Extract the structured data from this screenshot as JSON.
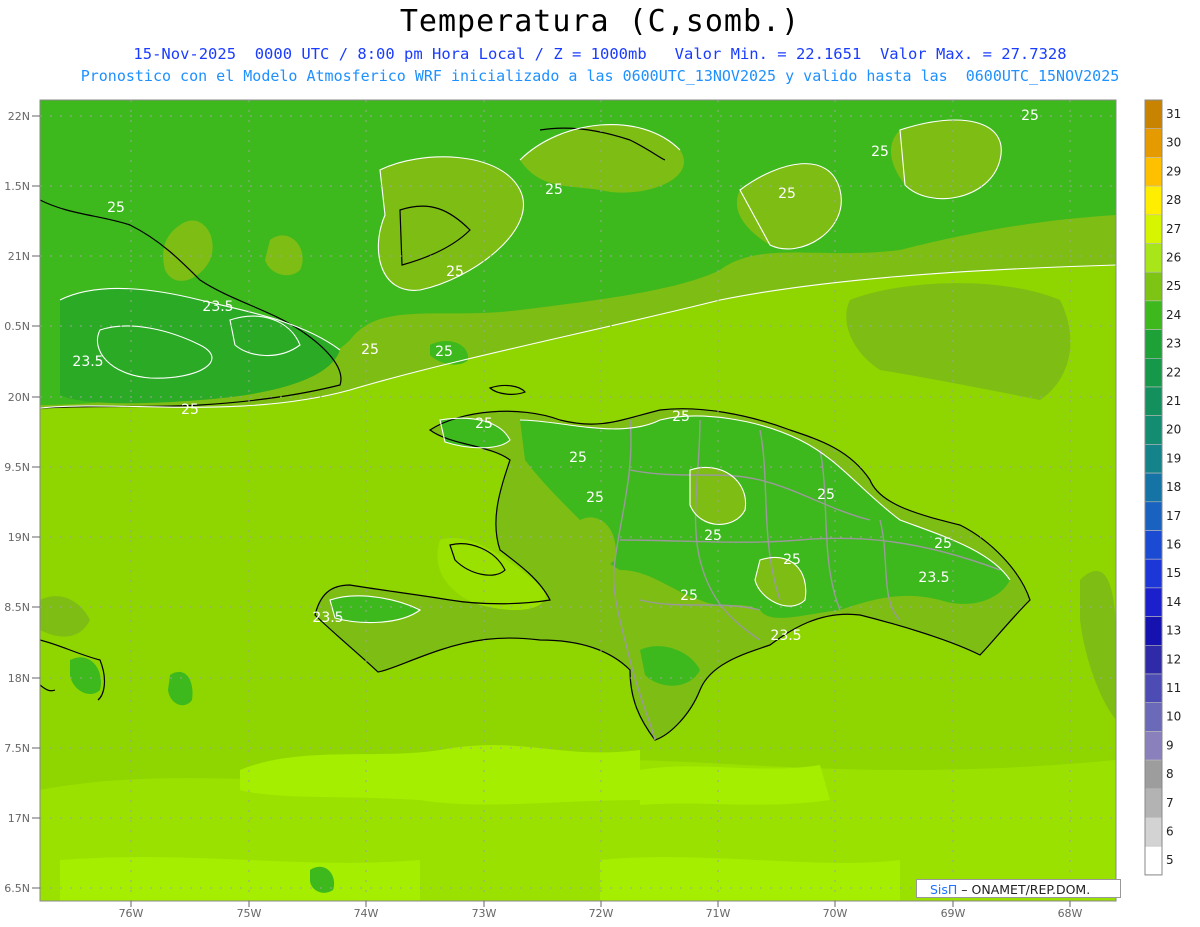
{
  "header": {
    "title": "Temperatura (C,somb.)",
    "line1": "15-Nov-2025  0000 UTC / 8:00 pm Hora Local / Z = 1000mb   Valor Min. = 22.1651  Valor Max. = 27.7328",
    "line2": "Pronostico con el Modelo Atmosferico WRF inicializado a las 0600UTC_13NOV2025 y valido hasta las  0600UTC_15NOV2025"
  },
  "map": {
    "lat_labels": [
      "22N",
      "1.5N",
      "21N",
      "0.5N",
      "20N",
      "9.5N",
      "19N",
      "8.5N",
      "18N",
      "7.5N",
      "17N",
      "6.5N"
    ],
    "lon_labels": [
      "76W",
      "75W",
      "74W",
      "73W",
      "72W",
      "71W",
      "70W",
      "69W",
      "68W"
    ],
    "contour_labels": [
      "25",
      "25",
      "25",
      "25",
      "25",
      "25",
      "25",
      "25",
      "25",
      "25",
      "25",
      "25",
      "25",
      "25",
      "25",
      "25",
      "25",
      "25",
      "23.5",
      "23.5",
      "23.5",
      "23.5",
      "23.5"
    ],
    "colorscale": {
      "labels": [
        "31",
        "30",
        "29",
        "28",
        "27",
        "26",
        "25",
        "24",
        "23",
        "22",
        "21",
        "20",
        "19",
        "18",
        "17",
        "16",
        "15",
        "14",
        "13",
        "12",
        "11",
        "10",
        "9",
        "8",
        "7",
        "6",
        "5"
      ],
      "colors": [
        "#c88300",
        "#e59a00",
        "#ffc000",
        "#ffee00",
        "#d5f500",
        "#a8e61a",
        "#7dc415",
        "#3db91d",
        "#1ea238",
        "#16984a",
        "#14905e",
        "#148c72",
        "#14848a",
        "#1673a5",
        "#1a62c0",
        "#1b4bd2",
        "#1c36d8",
        "#1c1fcc",
        "#1612b0",
        "#2e2aa8",
        "#4c4cb4",
        "#6a6ab8",
        "#8a80bc",
        "#9d9d9d",
        "#b3b3b3",
        "#d3d3d3",
        "#ffffff"
      ]
    }
  },
  "footer": {
    "brand": "SisΠ",
    "credit": " – ONAMET/REP.DOM."
  }
}
